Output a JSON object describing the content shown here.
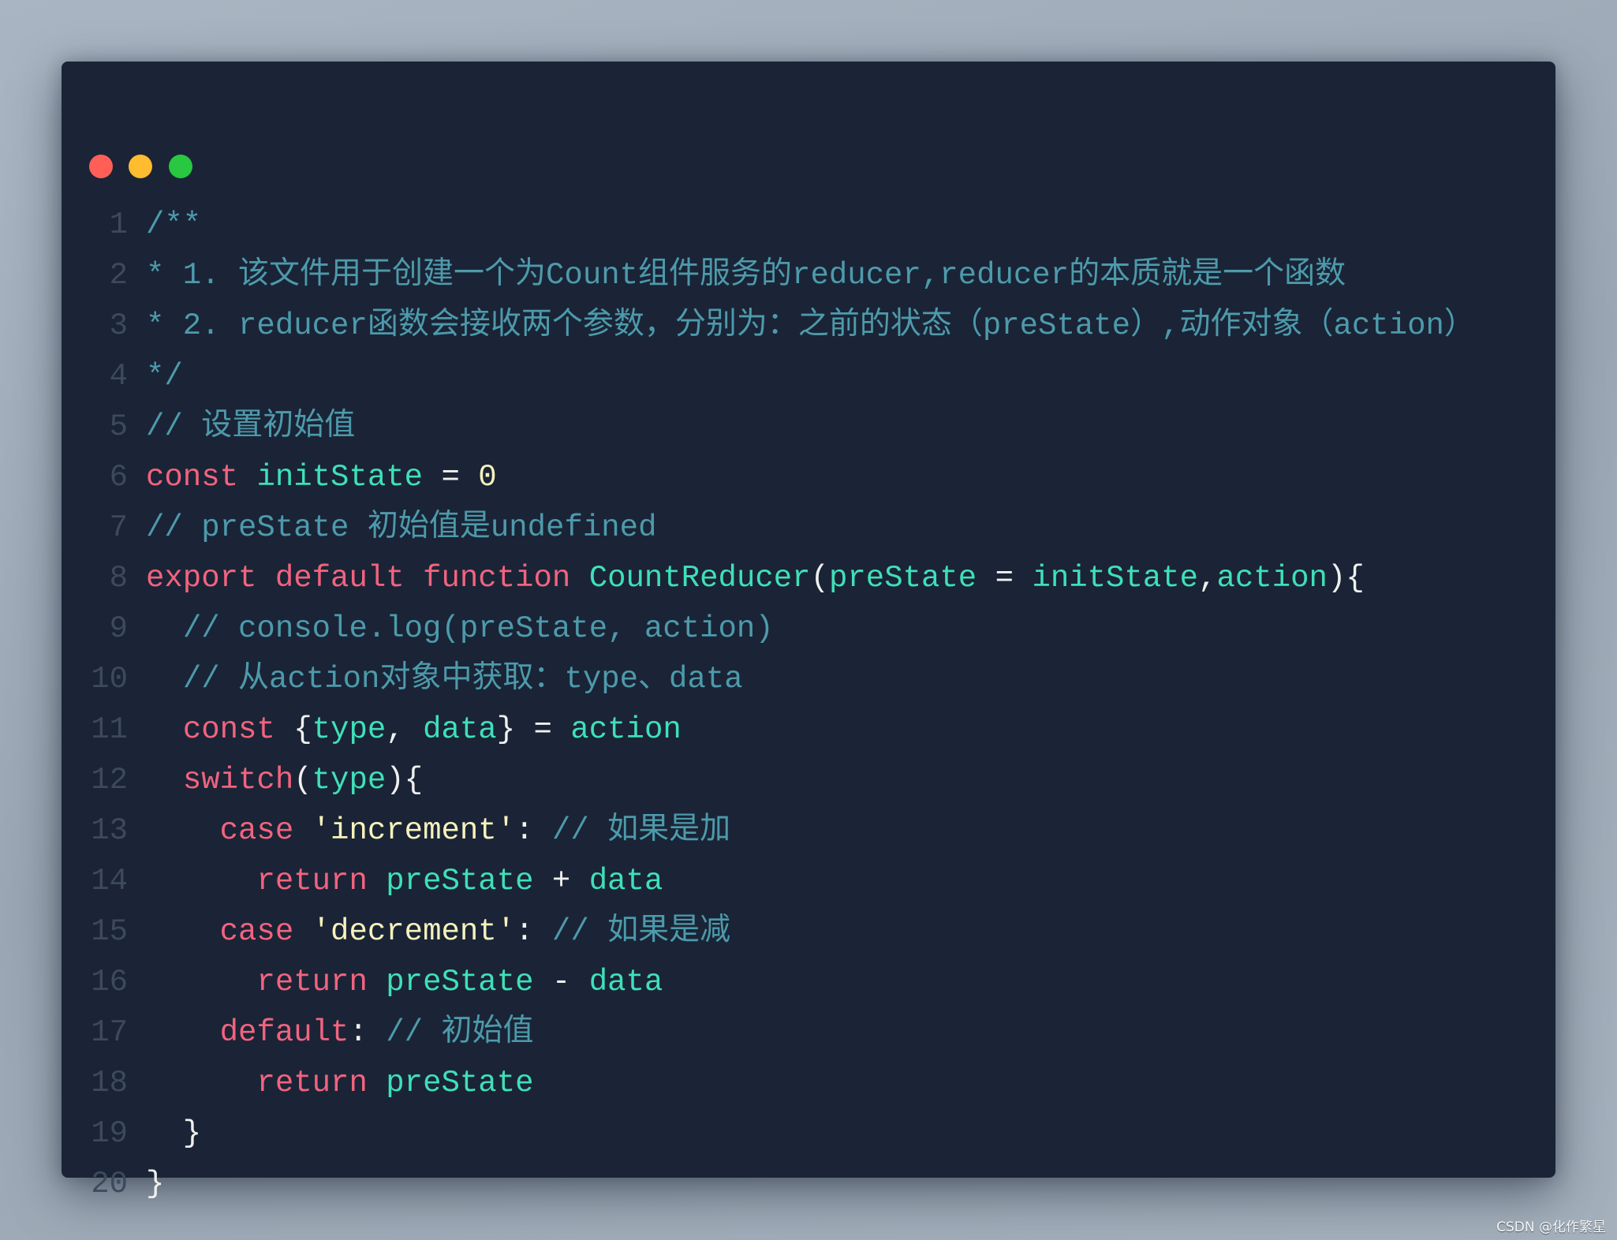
{
  "window": {
    "controls": [
      {
        "name": "close",
        "color": "#ff5f57"
      },
      {
        "name": "minimize",
        "color": "#febc2e"
      },
      {
        "name": "maximize",
        "color": "#28c840"
      }
    ]
  },
  "code": {
    "lines": [
      {
        "num": "1",
        "tokens": [
          {
            "t": "cm",
            "text": "/**"
          }
        ]
      },
      {
        "num": "2",
        "tokens": [
          {
            "t": "cm",
            "text": "* 1. 该文件用于创建一个为Count组件服务的reducer,reducer的本质就是一个函数"
          }
        ]
      },
      {
        "num": "3",
        "tokens": [
          {
            "t": "cm",
            "text": "* 2. reducer函数会接收两个参数，分别为：之前的状态（preState）,动作对象（action）"
          }
        ]
      },
      {
        "num": "4",
        "tokens": [
          {
            "t": "cm",
            "text": "*/"
          }
        ]
      },
      {
        "num": "5",
        "tokens": [
          {
            "t": "cm",
            "text": "// 设置初始值"
          }
        ]
      },
      {
        "num": "6",
        "tokens": [
          {
            "t": "kw",
            "text": "const"
          },
          {
            "t": "pl",
            "text": " "
          },
          {
            "t": "id",
            "text": "initState"
          },
          {
            "t": "pl",
            "text": " = "
          },
          {
            "t": "nm",
            "text": "0"
          }
        ]
      },
      {
        "num": "7",
        "tokens": [
          {
            "t": "cm",
            "text": "// preState 初始值是undefined"
          }
        ]
      },
      {
        "num": "8",
        "tokens": [
          {
            "t": "kw",
            "text": "export"
          },
          {
            "t": "pl",
            "text": " "
          },
          {
            "t": "kw",
            "text": "default"
          },
          {
            "t": "pl",
            "text": " "
          },
          {
            "t": "kw",
            "text": "function"
          },
          {
            "t": "pl",
            "text": " "
          },
          {
            "t": "id",
            "text": "CountReducer"
          },
          {
            "t": "pl",
            "text": "("
          },
          {
            "t": "id",
            "text": "preState"
          },
          {
            "t": "pl",
            "text": " = "
          },
          {
            "t": "id",
            "text": "initState"
          },
          {
            "t": "pl",
            "text": ","
          },
          {
            "t": "id",
            "text": "action"
          },
          {
            "t": "pl",
            "text": "){"
          }
        ]
      },
      {
        "num": "9",
        "tokens": [
          {
            "t": "pl",
            "text": "  "
          },
          {
            "t": "cm",
            "text": "// console.log(preState, action)"
          }
        ]
      },
      {
        "num": "10",
        "tokens": [
          {
            "t": "pl",
            "text": "  "
          },
          {
            "t": "cm",
            "text": "// 从action对象中获取：type、data"
          }
        ]
      },
      {
        "num": "11",
        "tokens": [
          {
            "t": "pl",
            "text": "  "
          },
          {
            "t": "kw",
            "text": "const"
          },
          {
            "t": "pl",
            "text": " {"
          },
          {
            "t": "id",
            "text": "type"
          },
          {
            "t": "pl",
            "text": ", "
          },
          {
            "t": "id",
            "text": "data"
          },
          {
            "t": "pl",
            "text": "} = "
          },
          {
            "t": "id",
            "text": "action"
          }
        ]
      },
      {
        "num": "12",
        "tokens": [
          {
            "t": "pl",
            "text": "  "
          },
          {
            "t": "kw",
            "text": "switch"
          },
          {
            "t": "pl",
            "text": "("
          },
          {
            "t": "id",
            "text": "type"
          },
          {
            "t": "pl",
            "text": "){"
          }
        ]
      },
      {
        "num": "13",
        "tokens": [
          {
            "t": "pl",
            "text": "    "
          },
          {
            "t": "kw",
            "text": "case"
          },
          {
            "t": "pl",
            "text": " "
          },
          {
            "t": "st",
            "text": "'increment'"
          },
          {
            "t": "pl",
            "text": ": "
          },
          {
            "t": "cm",
            "text": "// 如果是加"
          }
        ]
      },
      {
        "num": "14",
        "tokens": [
          {
            "t": "pl",
            "text": "      "
          },
          {
            "t": "kw",
            "text": "return"
          },
          {
            "t": "pl",
            "text": " "
          },
          {
            "t": "id",
            "text": "preState"
          },
          {
            "t": "pl",
            "text": " + "
          },
          {
            "t": "id",
            "text": "data"
          }
        ]
      },
      {
        "num": "15",
        "tokens": [
          {
            "t": "pl",
            "text": "    "
          },
          {
            "t": "kw",
            "text": "case"
          },
          {
            "t": "pl",
            "text": " "
          },
          {
            "t": "st",
            "text": "'decrement'"
          },
          {
            "t": "pl",
            "text": ": "
          },
          {
            "t": "cm",
            "text": "// 如果是减"
          }
        ]
      },
      {
        "num": "16",
        "tokens": [
          {
            "t": "pl",
            "text": "      "
          },
          {
            "t": "kw",
            "text": "return"
          },
          {
            "t": "pl",
            "text": " "
          },
          {
            "t": "id",
            "text": "preState"
          },
          {
            "t": "pl",
            "text": " - "
          },
          {
            "t": "id",
            "text": "data"
          }
        ]
      },
      {
        "num": "17",
        "tokens": [
          {
            "t": "pl",
            "text": "    "
          },
          {
            "t": "kw",
            "text": "default"
          },
          {
            "t": "pl",
            "text": ": "
          },
          {
            "t": "cm",
            "text": "// 初始值"
          }
        ]
      },
      {
        "num": "18",
        "tokens": [
          {
            "t": "pl",
            "text": "      "
          },
          {
            "t": "kw",
            "text": "return"
          },
          {
            "t": "pl",
            "text": " "
          },
          {
            "t": "id",
            "text": "preState"
          }
        ]
      },
      {
        "num": "19",
        "tokens": [
          {
            "t": "pl",
            "text": "  }"
          }
        ]
      },
      {
        "num": "20",
        "tokens": [
          {
            "t": "pl",
            "text": "}"
          }
        ]
      }
    ]
  },
  "watermark": "CSDN @化作繁星"
}
